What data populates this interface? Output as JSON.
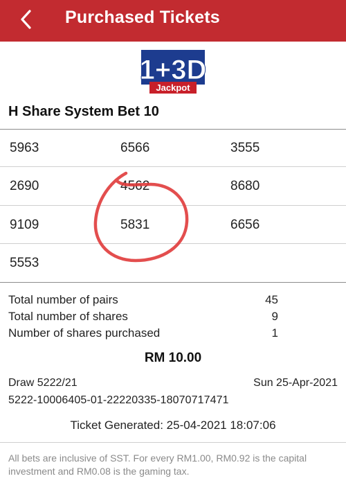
{
  "header": {
    "title": "Purchased Tickets",
    "back_icon": "chevron-left-icon",
    "background": "#c22b30"
  },
  "logo": {
    "main_text": "1+3D",
    "sub_text": "Jackpot",
    "colors": {
      "blue": "#1d3c8f",
      "red": "#c8202a",
      "white": "#ffffff"
    }
  },
  "bet": {
    "title": "H Share System Bet 10",
    "numbers": [
      [
        "5963",
        "6566",
        "3555"
      ],
      [
        "2690",
        "4562",
        "8680"
      ],
      [
        "9109",
        "5831",
        "6656"
      ],
      [
        "5553"
      ]
    ]
  },
  "summary": [
    {
      "label": "Total number of pairs",
      "value": "45"
    },
    {
      "label": "Total number of shares",
      "value": "9"
    },
    {
      "label": "Number of shares purchased",
      "value": "1"
    }
  ],
  "total_amount": "RM 10.00",
  "draw": {
    "label": "Draw 5222/21",
    "date": "Sun 25-Apr-2021",
    "ticket_number": "5222-10006405-01-22220335-18070717471"
  },
  "generated": "Ticket Generated: 25-04-2021 18:07:06",
  "disclaimer": "All bets are inclusive of SST. For every RM1.00, RM0.92 is the capital investment and RM0.08 is the gaming tax.",
  "annotation_color": "#e03b3b"
}
